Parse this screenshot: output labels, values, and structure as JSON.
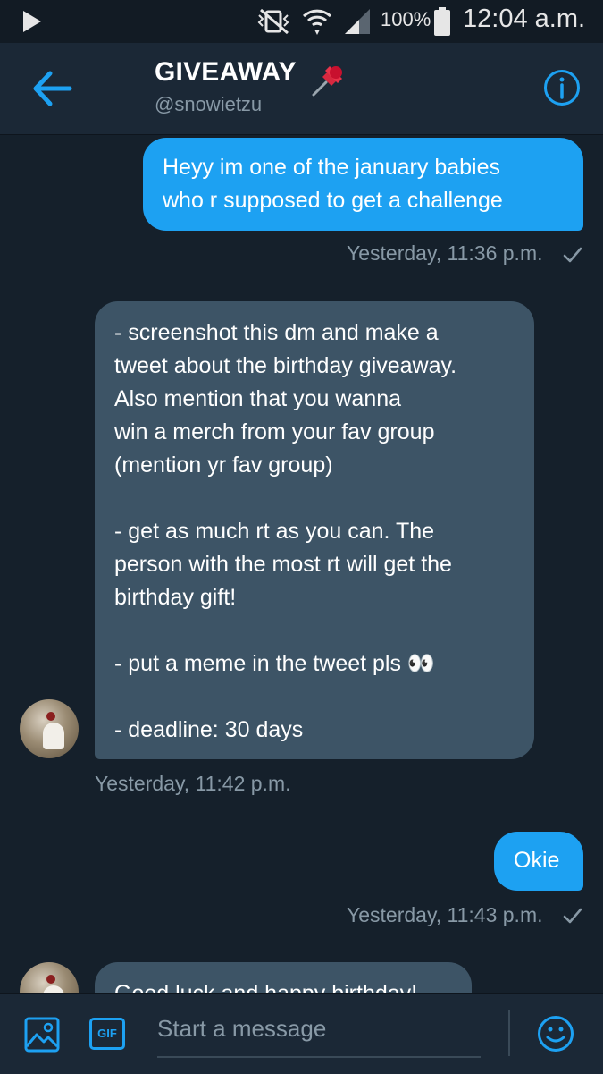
{
  "status_bar": {
    "battery": "100%",
    "time": "12:04 a.m."
  },
  "header": {
    "title": "GIVEAWAY",
    "handle": "@snowietzu"
  },
  "messages": [
    {
      "direction": "out",
      "text": "Heyy im one of the january babies\nwho r supposed to get a challenge",
      "timestamp": "Yesterday, 11:36 p.m.",
      "read": true
    },
    {
      "direction": "in",
      "text": "- screenshot this dm and make a\ntweet about the birthday giveaway.\nAlso mention that you wanna\nwin a merch from your fav group\n(mention yr fav group)\n\n- get as much rt as you can. The\nperson with the most rt will get the\nbirthday gift!\n\n- put a meme in the tweet pls 👀\n\n- deadline: 30 days",
      "timestamp": "Yesterday, 11:42 p.m."
    },
    {
      "direction": "out",
      "text": "Okie",
      "timestamp": "Yesterday, 11:43 p.m.",
      "read": true
    },
    {
      "direction": "in",
      "text": "Good luck and happy birthday!"
    }
  ],
  "composer": {
    "placeholder": "Start a message",
    "gif_label": "GIF"
  },
  "colors": {
    "accent": "#1da1f2",
    "background": "#15202b",
    "incoming_bubble": "#3d5466",
    "muted_text": "#8899a6"
  }
}
